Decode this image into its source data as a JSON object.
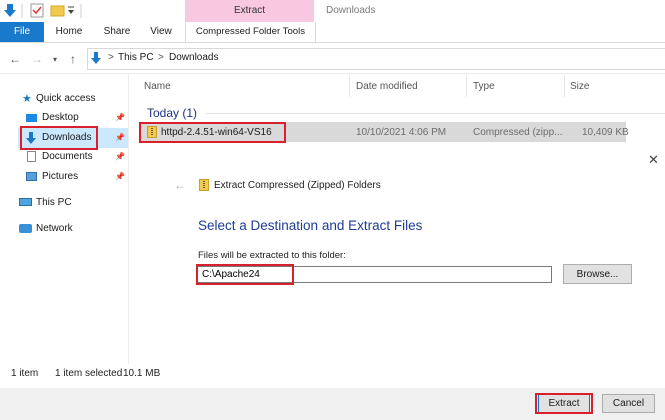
{
  "ribbon": {
    "tabs": {
      "file": "File",
      "home": "Home",
      "share": "Share",
      "view": "View"
    },
    "context_group": "Extract",
    "context_tab": "Compressed Folder Tools",
    "window_title": "Downloads"
  },
  "address": {
    "crumbs": [
      "This PC",
      "Downloads"
    ],
    "sep": ">"
  },
  "nav": {
    "items": [
      {
        "label": "Quick access"
      },
      {
        "label": "Desktop"
      },
      {
        "label": "Downloads"
      },
      {
        "label": "Documents"
      },
      {
        "label": "Pictures"
      },
      {
        "label": "This PC"
      },
      {
        "label": "Network"
      }
    ]
  },
  "columns": {
    "name": "Name",
    "date": "Date modified",
    "type": "Type",
    "size": "Size"
  },
  "group": "Today (1)",
  "file": {
    "name": "httpd-2.4.51-win64-VS16",
    "date": "10/10/2021 4:06 PM",
    "type": "Compressed (zipp...",
    "size": "10,409 KB"
  },
  "wizard": {
    "title": "Extract Compressed (Zipped) Folders",
    "heading": "Select a Destination and Extract Files",
    "field_label": "Files will be extracted to this folder:",
    "path_value": "C:\\Apache24",
    "browse_label": "Browse...",
    "extract_label": "Extract",
    "cancel_label": "Cancel"
  },
  "status": {
    "count": "1 item",
    "selected": "1 item selected",
    "size": "10.1 MB"
  },
  "colors": {
    "accent": "#1979ca",
    "context_tab": "#f8c7e0",
    "highlight": "#d6202b",
    "heading": "#1e3c96"
  }
}
